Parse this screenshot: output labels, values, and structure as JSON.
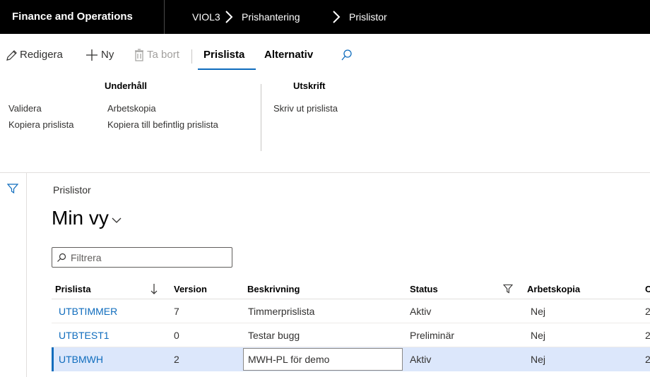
{
  "topbar": {
    "app_title": "Finance and Operations",
    "breadcrumbs": [
      "VIOL3",
      "Prishantering",
      "Prislistor"
    ]
  },
  "action_pane": {
    "edit": "Redigera",
    "new": "Ny",
    "delete": "Ta bort",
    "tab_active": "Prislista",
    "tab_options": "Alternativ"
  },
  "ribbon": {
    "groups": [
      {
        "title": "Underhåll",
        "buttons": [
          "Validera",
          "Kopiera prislista",
          "Arbetskopia",
          "Kopiera till befintlig prislista"
        ]
      },
      {
        "title": "Utskrift",
        "buttons": [
          "Skriv ut prislista"
        ]
      }
    ]
  },
  "page": {
    "caption": "Prislistor",
    "view_name": "Min vy"
  },
  "filter": {
    "placeholder": "Filtrera"
  },
  "grid": {
    "columns": [
      "Prislista",
      "Version",
      "Beskrivning",
      "Status",
      "Arbetskopia"
    ],
    "truncated_column_initial": "C",
    "rows": [
      {
        "prislista": "UTBTIMMER",
        "version": "7",
        "beskrivning": "Timmerprislista",
        "status": "Aktiv",
        "arbetskopia": "Nej",
        "trunc": "2"
      },
      {
        "prislista": "UTBTEST1",
        "version": "0",
        "beskrivning": "Testar bugg",
        "status": "Preliminär",
        "arbetskopia": "Nej",
        "trunc": "2"
      },
      {
        "prislista": "UTBMWH",
        "version": "2",
        "beskrivning": "MWH-PL för demo",
        "status": "Aktiv",
        "arbetskopia": "Nej",
        "trunc": "2"
      }
    ],
    "selected_row": 2
  },
  "colors": {
    "accent": "#0f6cbd",
    "selected_row": "#dce7fb",
    "topbar": "#000000"
  },
  "icons": [
    "pencil-icon",
    "plus-icon",
    "trash-icon",
    "search-icon",
    "chevron-right-icon",
    "chevron-down-icon",
    "filter-icon",
    "sort-down-arrow-icon"
  ]
}
